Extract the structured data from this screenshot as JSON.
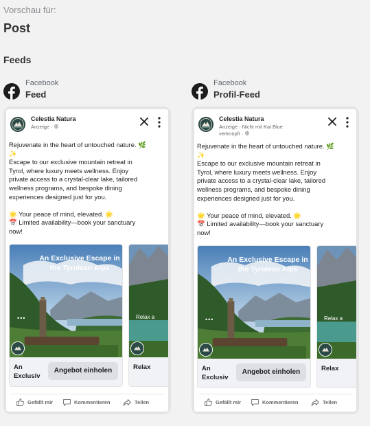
{
  "header": {
    "preview_label": "Vorschau für:",
    "post_title": "Post",
    "feeds_label": "Feeds"
  },
  "columns": [
    {
      "platform": "Facebook",
      "placement": "Feed",
      "page_name": "Celestia Natura",
      "sponsored_line1": "Anzeige · ",
      "sponsored_line2": "",
      "text_lines": [
        "Rejuvenate in the heart of untouched nature. 🌿",
        "✨",
        "Escape to our exclusive mountain retreat in",
        "Tyrol, where luxury meets wellness. Enjoy",
        "private access to a crystal-clear lake, tailored",
        "wellness programs, and bespoke dining",
        "experiences designed just for you."
      ],
      "text_lines2": [
        "🌟 Your peace of mind, elevated. 🌟",
        "📅 Limited availability—book your sanctuary",
        "now!"
      ],
      "card1": {
        "overlay": "An Exclusive Escape in the Tyrolean Alps",
        "headline_line1": "An",
        "headline_line2": "Exclusiv",
        "cta": "Angebot einholen"
      },
      "card2": {
        "overlay": "Relax a",
        "headline_line1": "Relax",
        "headline_line2": ""
      },
      "actions": {
        "like": "Gefällt mir",
        "comment": "Kommentieren",
        "share": "Teilen"
      }
    },
    {
      "platform": "Facebook",
      "placement": "Profil-Feed",
      "page_name": "Celestia Natura",
      "sponsored_line1": "Anzeige · Nicht mit Kai Blue",
      "sponsored_line2": "verknüpft · ",
      "text_lines": [
        "Rejuvenate in the heart of untouched nature. 🌿",
        "✨",
        "Escape to our exclusive mountain retreat in",
        "Tyrol, where luxury meets wellness. Enjoy",
        "private access to a crystal-clear lake, tailored",
        "wellness programs, and bespoke dining",
        "experiences designed just for you."
      ],
      "text_lines2": [
        "🌟 Your peace of mind, elevated. 🌟",
        "📅 Limited availability—book your sanctuary",
        "now!"
      ],
      "card1": {
        "overlay": "An Exclusive Escape in the Tyrolean Alps",
        "headline_line1": "An",
        "headline_line2": "Exclusiv",
        "cta": "Angebot einholen"
      },
      "card2": {
        "overlay": "Relax a",
        "headline_line1": "Relax",
        "headline_line2": ""
      },
      "actions": {
        "like": "Gefällt mir",
        "comment": "Kommentieren",
        "share": "Teilen"
      }
    }
  ],
  "icons": {
    "facebook": "facebook-logo-icon",
    "close": "close-icon",
    "more": "more-vertical-icon",
    "like": "thumbs-up-icon",
    "comment": "comment-icon",
    "share": "share-icon",
    "globe": "globe-icon"
  },
  "colors": {
    "background": "#f2f2f2",
    "text_dark": "#1c1e21",
    "muted": "#65676b",
    "cta_bg": "#dedfe3"
  }
}
